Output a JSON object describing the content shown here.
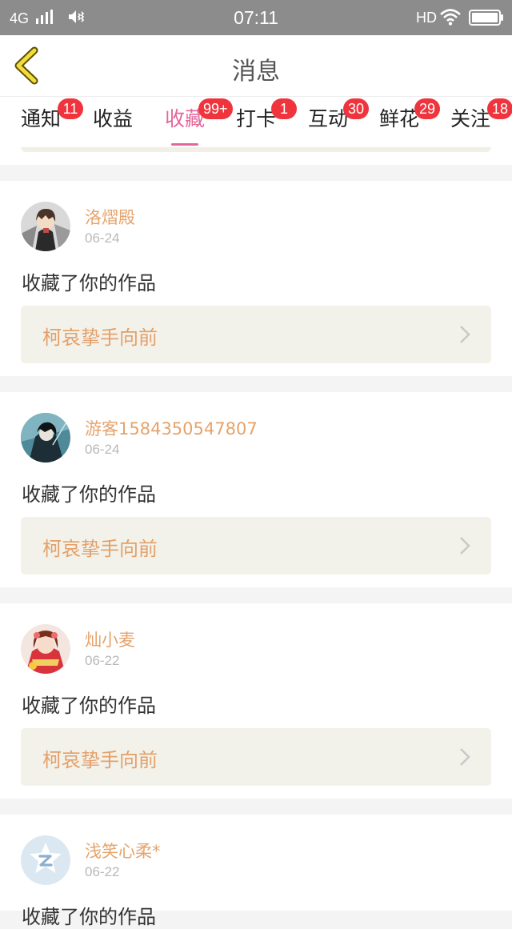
{
  "status": {
    "network": "4G",
    "time": "07:11",
    "hd": "HD"
  },
  "nav": {
    "title": "消息",
    "back_icon": "chevron-left-icon"
  },
  "tabs": [
    {
      "label": "通知",
      "badge": "11",
      "active": false
    },
    {
      "label": "收益",
      "badge": "",
      "active": false
    },
    {
      "label": "收藏",
      "badge": "99+",
      "active": true
    },
    {
      "label": "打卡",
      "badge": "1",
      "active": false
    },
    {
      "label": "互动",
      "badge": "30",
      "active": false
    },
    {
      "label": "鲜花",
      "badge": "29",
      "active": false
    },
    {
      "label": "关注",
      "badge": "18",
      "active": false
    }
  ],
  "messages": [
    {
      "user": "洛熠殿",
      "date": "06-24",
      "action": "收藏了你的作品",
      "work": "柯哀挚手向前"
    },
    {
      "user": "游客1584350547807",
      "date": "06-24",
      "action": "收藏了你的作品",
      "work": "柯哀挚手向前"
    },
    {
      "user": "灿小麦",
      "date": "06-22",
      "action": "收藏了你的作品",
      "work": "柯哀挚手向前"
    },
    {
      "user": "浅笑心柔*",
      "date": "06-22",
      "action": "收藏了你的作品",
      "work": ""
    }
  ],
  "colors": {
    "accent": "#e4679b",
    "badge": "#f0343d",
    "username": "#e5a36b",
    "work_title": "#e3a06a",
    "work_bg": "#f3f2ea",
    "status_bar": "#8c8c8c"
  }
}
